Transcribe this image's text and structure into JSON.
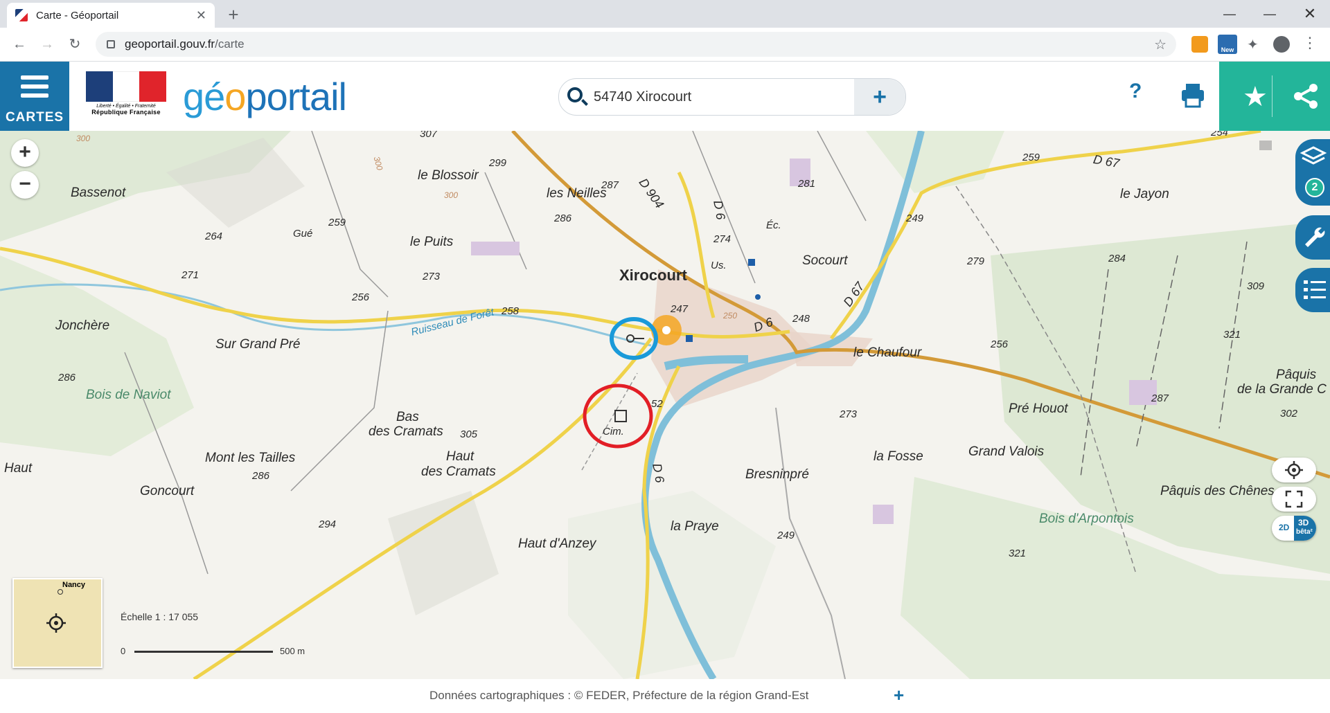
{
  "browser": {
    "tab_title": "Carte - Géoportail",
    "url_host": "geoportail.gouv.fr",
    "url_path": "/carte",
    "ext_badge": "New"
  },
  "header": {
    "menu_label": "CARTES",
    "logo_text": "géoportail",
    "marianne_motto": "Liberté • Égalité • Fraternité",
    "marianne_rf": "République Française",
    "search_value": "54740 Xirocourt",
    "help_label": "?",
    "colors": {
      "blue": "#1a73a8",
      "teal": "#23b59a",
      "orange": "#f5a623"
    }
  },
  "map": {
    "labels": {
      "blossoir": "le Blossoir",
      "neilles": "les Neilles",
      "puits": "le Puits",
      "bassenot": "Bassenot",
      "gue": "Gué",
      "joncheres": "Jonchère",
      "sur_grand_pre": "Sur Grand Pré",
      "bois_naviot": "Bois de Naviot",
      "bas_cramats_1": "Bas",
      "bas_cramats_2": "des Cramats",
      "haut_cramats_1": "Haut",
      "haut_cramats_2": "des Cramats",
      "mont_tailles": "Mont les Tailles",
      "goncourt": "Goncourt",
      "haut_anzey": "Haut d'Anzey",
      "haut_left": "Haut",
      "xirocourt": "Xirocourt",
      "socourt": "Socourt",
      "chaufour": "le Chaufour",
      "jayon": "le Jayon",
      "pre_houot": "Pré Houot",
      "la_fosse": "la Fosse",
      "grand_valois": "Grand Valois",
      "bresninpre": "Bresninpré",
      "la_praye": "la Praye",
      "paquis_1": "Pâquis",
      "paquis_2": "de la Grande C",
      "paquis_chenes": "Pâquis des Chênes",
      "bois_arpontois": "Bois d'Arpontois",
      "ruisseau": "Ruisseau de Forêt",
      "cim": "Cim.",
      "ec": "Éc.",
      "us": "Us.",
      "d904": "D 904",
      "d6_a": "D 6",
      "d6_b": "D 6",
      "d6_c": "D 6",
      "d67_a": "D 67",
      "d67_b": "D 67"
    },
    "elevations": {
      "e307": "307",
      "e299": "299",
      "e287": "287",
      "e286": "286",
      "e273": "273",
      "e300a": "300",
      "e300b": "300",
      "e300c": "300",
      "e259": "259",
      "e264": "264",
      "e271": "271",
      "e256a": "256",
      "e258": "258",
      "e281": "281",
      "e274": "274",
      "e247": "247",
      "e250": "250",
      "e248": "248",
      "e279": "279",
      "e249a": "249",
      "e259b": "259",
      "e284": "284",
      "e309": "309",
      "e321": "321",
      "e256b": "256",
      "e287b": "287",
      "e302": "302",
      "e273b": "273",
      "e305": "305",
      "e286b": "286",
      "e286c": "286",
      "e294": "294",
      "e249b": "249",
      "e252": "52",
      "e254": "254",
      "e321b": "321"
    },
    "minimap_label": "Nancy",
    "scale_text": "Échelle 1 : 17 055",
    "scale_zero": "0",
    "scale_end": "500 m",
    "layers_count": "2",
    "view2d": "2D",
    "view3d": "3D",
    "beta": "bêta²"
  },
  "footer": {
    "attribution": "Données cartographiques :  ©    FEDER,  Préfecture de la région Grand-Est",
    "more": "+"
  }
}
